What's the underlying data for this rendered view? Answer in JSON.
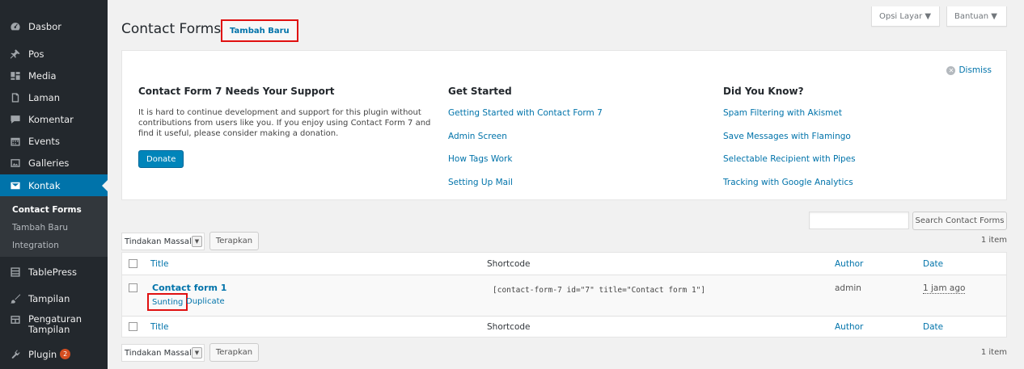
{
  "sidebar": {
    "items": [
      {
        "label": "Dasbor",
        "icon": "dashboard-icon"
      },
      {
        "label": "Pos",
        "icon": "pin-icon"
      },
      {
        "label": "Media",
        "icon": "media-icon"
      },
      {
        "label": "Laman",
        "icon": "page-icon"
      },
      {
        "label": "Komentar",
        "icon": "comment-icon"
      },
      {
        "label": "Events",
        "icon": "calendar-icon"
      },
      {
        "label": "Galleries",
        "icon": "gallery-icon"
      },
      {
        "label": "Kontak",
        "icon": "mail-icon"
      },
      {
        "label": "TablePress",
        "icon": "table-icon"
      },
      {
        "label": "Tampilan",
        "icon": "brush-icon"
      },
      {
        "label_line1": "Pengaturan",
        "label_line2": "Tampilan",
        "icon": "settings-panel-icon"
      },
      {
        "label": "Plugin",
        "icon": "plugin-icon",
        "badge": "2"
      }
    ],
    "submenu": [
      "Contact Forms",
      "Tambah Baru",
      "Integration"
    ]
  },
  "header": {
    "title": "Contact Forms",
    "add_new": "Tambah Baru",
    "screen_options": "Opsi Layar ▼",
    "help": "Bantuan ▼"
  },
  "welcome": {
    "dismiss": "Dismiss",
    "col1_heading": "Contact Form 7 Needs Your Support",
    "col1_text": "It is hard to continue development and support for this plugin without contributions from users like you. If you enjoy using Contact Form 7 and find it useful, please consider making a donation.",
    "donate": "Donate",
    "col2_heading": "Get Started",
    "col2_links": [
      "Getting Started with Contact Form 7",
      "Admin Screen",
      "How Tags Work",
      "Setting Up Mail"
    ],
    "col3_heading": "Did You Know?",
    "col3_links": [
      "Spam Filtering with Akismet",
      "Save Messages with Flamingo",
      "Selectable Recipient with Pipes",
      "Tracking with Google Analytics"
    ]
  },
  "search": {
    "button": "Search Contact Forms",
    "value": ""
  },
  "bulk": {
    "select": "Tindakan Massal",
    "apply": "Terapkan",
    "count": "1 item"
  },
  "table": {
    "columns": [
      "Title",
      "Shortcode",
      "Author",
      "Date"
    ],
    "rows": [
      {
        "title": "Contact form 1",
        "shortcode": "[contact-form-7 id=\"7\" title=\"Contact form 1\"]",
        "author": "admin",
        "date": "1 jam ago",
        "actions": [
          "Sunting",
          "Duplicate"
        ]
      }
    ]
  },
  "colors": {
    "sidebar": "#23282d",
    "accent": "#0073aa",
    "highlight": "#e01010"
  }
}
